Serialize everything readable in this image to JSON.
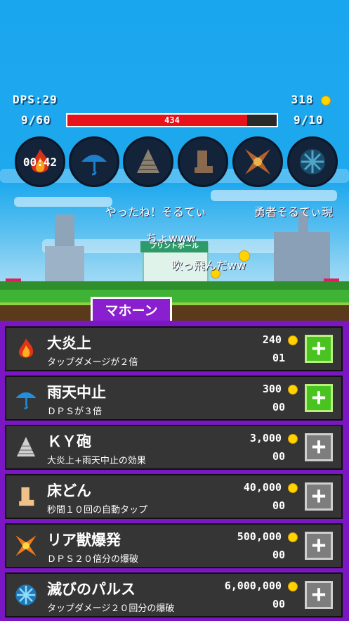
{
  "hud": {
    "dps": "DPS:29",
    "coins": "318",
    "stage_left": "9/60",
    "stage_right": "9/10",
    "hp_value": "434",
    "hp_fraction": 0.86
  },
  "skills": [
    {
      "icon": "fire-icon",
      "timer": "00:42"
    },
    {
      "icon": "umbrella-icon"
    },
    {
      "icon": "cone-icon"
    },
    {
      "icon": "foot-icon"
    },
    {
      "icon": "explosion-icon"
    },
    {
      "icon": "snowflake-icon"
    }
  ],
  "chat": {
    "line1": "やったね！そるてぃ",
    "line2": "勇者そるてぃ現",
    "line3": "ちょwww",
    "line4": "吹っ飛んだww"
  },
  "building_sign": "プリントポール",
  "tab_label": "マホーン",
  "items": [
    {
      "name": "大炎上",
      "desc": "タップダメージが２倍",
      "price": "240",
      "level": "01",
      "enabled": true,
      "icon": "fire-icon"
    },
    {
      "name": "雨天中止",
      "desc": "ＤＰＳが３倍",
      "price": "300",
      "level": "00",
      "enabled": true,
      "icon": "umbrella-icon"
    },
    {
      "name": "ＫＹ砲",
      "desc": "大炎上+雨天中止の効果",
      "price": "3,000",
      "level": "00",
      "enabled": false,
      "icon": "cone-icon"
    },
    {
      "name": "床どん",
      "desc": "秒間１０回の自動タップ",
      "price": "40,000",
      "level": "00",
      "enabled": false,
      "icon": "foot-icon"
    },
    {
      "name": "リア獣爆発",
      "desc": "ＤＰＳ２０倍分の爆破",
      "price": "500,000",
      "level": "00",
      "enabled": false,
      "icon": "explosion-icon"
    },
    {
      "name": "滅びのパルス",
      "desc": "タップダメージ２０回分の爆破",
      "price": "6,000,000",
      "level": "00",
      "enabled": false,
      "icon": "snowflake-icon"
    }
  ],
  "colors": {
    "accent": "#7a16c2",
    "plus_enabled": "#49c31f",
    "plus_disabled": "#7d7d7d",
    "hp": "#e8121b"
  }
}
